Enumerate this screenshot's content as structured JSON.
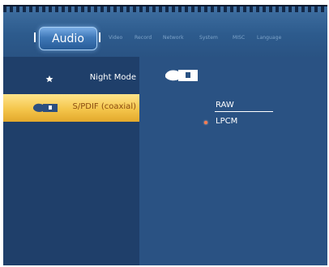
{
  "tabs": {
    "active": "Audio",
    "others": [
      "Video",
      "Record",
      "Network",
      "System",
      "MISC",
      "Language"
    ]
  },
  "sidebar": {
    "items": [
      {
        "label": "Night Mode",
        "icon": "moon-star-icon"
      },
      {
        "label": "S/PDIF (coaxial)",
        "icon": "spdif-icon"
      }
    ]
  },
  "content": {
    "header_icon": "spdif-icon",
    "options": [
      "RAW",
      "LPCM"
    ],
    "selected_option": "LPCM"
  },
  "colors": {
    "background": "#1f3f6a",
    "content_panel": "#2a5283",
    "selected_item": "#f4c54b",
    "selected_text": "#8a4b10",
    "tab_active": "#3f78b8",
    "radio_dot": "#ff7a4f"
  }
}
